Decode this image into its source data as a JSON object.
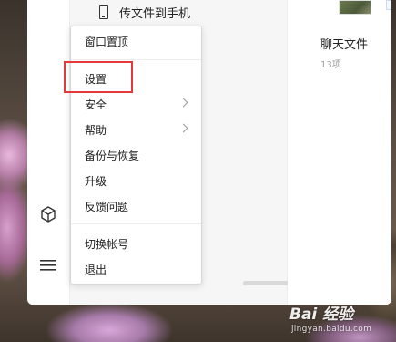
{
  "list": {
    "send_to_phone_label": "传文件到手机"
  },
  "right_pane": {
    "chat_files_title": "聊天文件",
    "chat_files_count": "13项"
  },
  "menu": {
    "items": [
      {
        "label": "窗口置顶",
        "submenu": false
      },
      {
        "label": "设置",
        "submenu": false,
        "highlighted": true
      },
      {
        "label": "安全",
        "submenu": true
      },
      {
        "label": "帮助",
        "submenu": true
      },
      {
        "label": "备份与恢复",
        "submenu": false
      },
      {
        "label": "升级",
        "submenu": false
      },
      {
        "label": "反馈问题",
        "submenu": false
      },
      {
        "label": "切换帐号",
        "submenu": false
      },
      {
        "label": "退出",
        "submenu": false
      }
    ]
  },
  "watermark": {
    "logo": "Bai 经验",
    "url": "jingyan.baidu.com"
  },
  "colors": {
    "highlight_border": "#e5383b",
    "menu_bg": "#ffffff",
    "pane_bg": "#f6f6f6"
  },
  "icons": {
    "mini_program": "cube-icon",
    "menu_button": "hamburger-icon",
    "send_to_phone": "phone-icon"
  }
}
